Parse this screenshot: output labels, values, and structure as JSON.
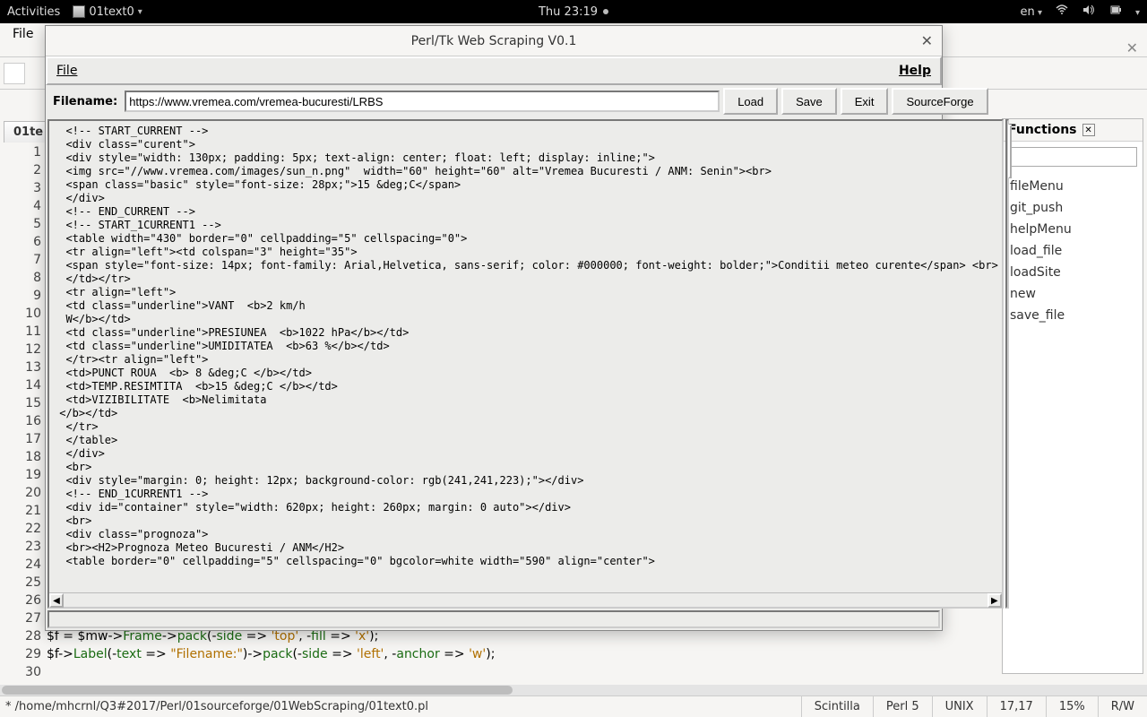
{
  "topbar": {
    "activities": "Activities",
    "app": "01text0",
    "clock": "Thu 23:19",
    "lang": "en"
  },
  "behind": {
    "file_menu": "File",
    "tab": "01te"
  },
  "dialog": {
    "title": "Perl/Tk Web Scraping V0.1",
    "menu_file": "File",
    "menu_help": "Help",
    "filename_label": "Filename:",
    "filename_value": "https://www.vremea.com/vremea-bucuresti/LRBS",
    "btn_load": "Load",
    "btn_save": "Save",
    "btn_exit": "Exit",
    "btn_sf": "SourceForge",
    "lines": [
      "  <!-- START_CURRENT -->",
      "  <div class=\"curent\">",
      "  <div style=\"width: 130px; padding: 5px; text-align: center; float: left; display: inline;\">",
      "  <img src=\"//www.vremea.com/images/sun_n.png\"  width=\"60\" height=\"60\" alt=\"Vremea Bucuresti / ANM: Senin\"><br>",
      "  <span class=\"basic\" style=\"font-size: 28px;\">15 &deg;C</span>",
      "  </div>",
      "  <!-- END_CURRENT -->",
      "  <!-- START_1CURRENT1 -->",
      "  <table width=\"430\" border=\"0\" cellpadding=\"5\" cellspacing=\"0\">",
      "  <tr align=\"left\"><td colspan=\"3\" height=\"35\">",
      "  <span style=\"font-size: 14px; font-family: Arial,Helvetica, sans-serif; color: #000000; font-weight: bolder;\">Conditii meteo curente</span> <br>",
      "  </td></tr>",
      "  <tr align=\"left\">",
      "  <td class=\"underline\">VANT  <b>2 km/h",
      "  W</b></td>",
      "  <td class=\"underline\">PRESIUNEA  <b>1022 hPa</b></td>",
      "  <td class=\"underline\">UMIDITATEA  <b>63 %</b></td>",
      "  </tr><tr align=\"left\">",
      "  <td>PUNCT ROUA  <b> 8 &deg;C </b></td>",
      "  <td>TEMP.RESIMTITA  <b>15 &deg;C </b></td>",
      "  <td>VIZIBILITATE  <b>Nelimitata",
      " </b></td>",
      "  </tr>",
      "  </table>",
      "  </div>",
      "  <br>",
      "  <div style=\"margin: 0; height: 12px; background-color: rgb(241,241,223);\"></div>",
      "  <!-- END_1CURRENT1 -->",
      "  <div id=\"container\" style=\"width: 620px; height: 260px; margin: 0 auto\"></div>",
      "  <br>",
      "  <div class=\"prognoza\">",
      "  <br><H2>Prognoza Meteo Bucuresti / ANM</H2>",
      "  <table border=\"0\" cellpadding=\"5\" cellspacing=\"0\" bgcolor=white width=\"590\" align=\"center\">"
    ]
  },
  "gutter_start": 1,
  "gutter_end": 30,
  "functions": {
    "title": "Functions",
    "items": [
      "fileMenu",
      "git_push",
      "helpMenu",
      "load_file",
      "loadSite",
      "new",
      "save_file"
    ]
  },
  "code_below": {
    "l28": {
      "a": "$f ",
      "b": "= ",
      "c": "$mw",
      "d": "->",
      "e": "Frame",
      "f": "->",
      "g": "pack",
      "h": "(-",
      "i": "side",
      "j": " => ",
      "k": "'top'",
      "l": ", -",
      "m": "fill",
      "n": " => ",
      "o": "'x'",
      "p": ");"
    },
    "l29": {
      "a": "$f",
      "b": "->",
      "c": "Label",
      "d": "(-",
      "e": "text",
      "f": " => ",
      "g": "\"Filename:\"",
      "h": ")->",
      "i": "pack",
      "j": "(-",
      "k": "side",
      "l": " => ",
      "m": "'left'",
      "n": ", -",
      "o": "anchor",
      "p": " => ",
      "q": "'w'",
      "r": ");"
    }
  },
  "statusbar": {
    "path": "* /home/mhcrnl/Q3#2017/Perl/01sourceforge/01WebScraping/01text0.pl",
    "lexer": "Scintilla",
    "lang": "Perl 5",
    "eol": "UNIX",
    "pos": "17,17",
    "pct": "15%",
    "rw": "R/W"
  }
}
